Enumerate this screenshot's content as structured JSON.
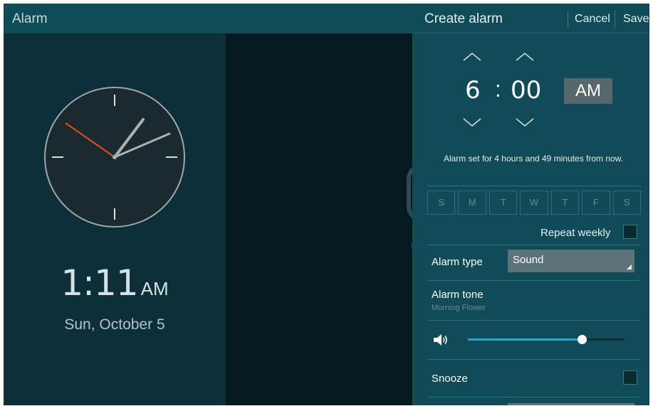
{
  "app": {
    "title": "Alarm"
  },
  "clock": {
    "time": "1:11",
    "ampm": "AM",
    "date": "Sun, October 5"
  },
  "create_alarm": {
    "title": "Create alarm",
    "cancel_label": "Cancel",
    "save_label": "Save",
    "hour": "6",
    "separator": ":",
    "minute": "00",
    "ampm": "AM",
    "countdown": "Alarm set for 4 hours and 49 minutes from now.",
    "days": [
      "S",
      "M",
      "T",
      "W",
      "T",
      "F",
      "S"
    ],
    "repeat_label": "Repeat weekly",
    "repeat_checked": false,
    "alarm_type_label": "Alarm type",
    "alarm_type_value": "Sound",
    "alarm_tone_label": "Alarm tone",
    "alarm_tone_value": "Morning Flower",
    "volume_level": 0.73,
    "snooze_label": "Snooze",
    "snooze_checked": false
  },
  "icons": {
    "volume": "volume-icon",
    "up": "chevron-up-icon",
    "down": "chevron-down-icon"
  },
  "colors": {
    "header": "#0e4c57",
    "panel": "#104b57",
    "accent": "#2e9fd3",
    "second_hand": "#e2501c"
  }
}
